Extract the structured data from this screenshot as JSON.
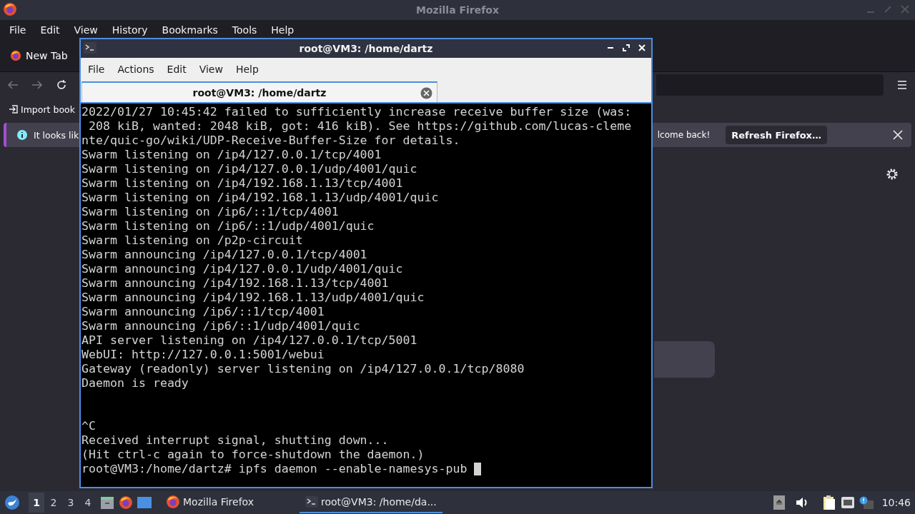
{
  "firefox": {
    "title": "Mozilla Firefox",
    "menu": [
      "File",
      "Edit",
      "View",
      "History",
      "Bookmarks",
      "Tools",
      "Help"
    ],
    "tabs": [
      {
        "label": "New Tab",
        "selected": true
      }
    ],
    "bookmarks": [
      {
        "label": "Import book"
      }
    ],
    "notice": {
      "text_start": "It looks lik",
      "text_end": "lcome back!",
      "button": "Refresh Firefox…"
    }
  },
  "terminal": {
    "title": "root@VM3: /home/dartz",
    "menu": [
      "File",
      "Actions",
      "Edit",
      "View",
      "Help"
    ],
    "tabs": [
      {
        "label": "root@VM3: /home/dartz",
        "selected": true
      }
    ],
    "blocks": [
      [
        "2022/01/27 10:45:42 failed to sufficiently increase receive buffer size (was:",
        " 208 kiB, wanted: 2048 kiB, got: 416 kiB). See https://github.com/lucas-cleme",
        "nte/quic-go/wiki/UDP-Receive-Buffer-Size for details.",
        "Swarm listening on /ip4/127.0.0.1/tcp/4001",
        "Swarm listening on /ip4/127.0.0.1/udp/4001/quic",
        "Swarm listening on /ip4/192.168.1.13/tcp/4001",
        "Swarm listening on /ip4/192.168.1.13/udp/4001/quic",
        "Swarm listening on /ip6/::1/tcp/4001",
        "Swarm listening on /ip6/::1/udp/4001/quic",
        "Swarm listening on /p2p-circuit",
        "Swarm announcing /ip4/127.0.0.1/tcp/4001",
        "Swarm announcing /ip4/127.0.0.1/udp/4001/quic",
        "Swarm announcing /ip4/192.168.1.13/tcp/4001",
        "Swarm announcing /ip4/192.168.1.13/udp/4001/quic",
        "Swarm announcing /ip6/::1/tcp/4001",
        "Swarm announcing /ip6/::1/udp/4001/quic",
        "API server listening on /ip4/127.0.0.1/tcp/5001",
        "WebUI: http://127.0.0.1:5001/webui",
        "Gateway (readonly) server listening on /ip4/127.0.0.1/tcp/8080",
        "Daemon is ready"
      ],
      [
        "^C",
        "Received interrupt signal, shutting down...",
        "(Hit ctrl-c again to force-shutdown the daemon.)"
      ]
    ],
    "prompt": "root@VM3:/home/dartz# ipfs daemon --enable-namesys-pub"
  },
  "taskbar": {
    "workspaces": [
      {
        "label": "1",
        "selected": true
      },
      {
        "label": "2",
        "selected": false
      },
      {
        "label": "3",
        "selected": false
      },
      {
        "label": "4",
        "selected": false
      }
    ],
    "tasks": [
      {
        "kind": "browser",
        "label": "Mozilla Firefox",
        "selected": false
      },
      {
        "kind": "terminal",
        "label": "root@VM3: /home/da...",
        "selected": true
      }
    ],
    "clock": "10:46"
  }
}
